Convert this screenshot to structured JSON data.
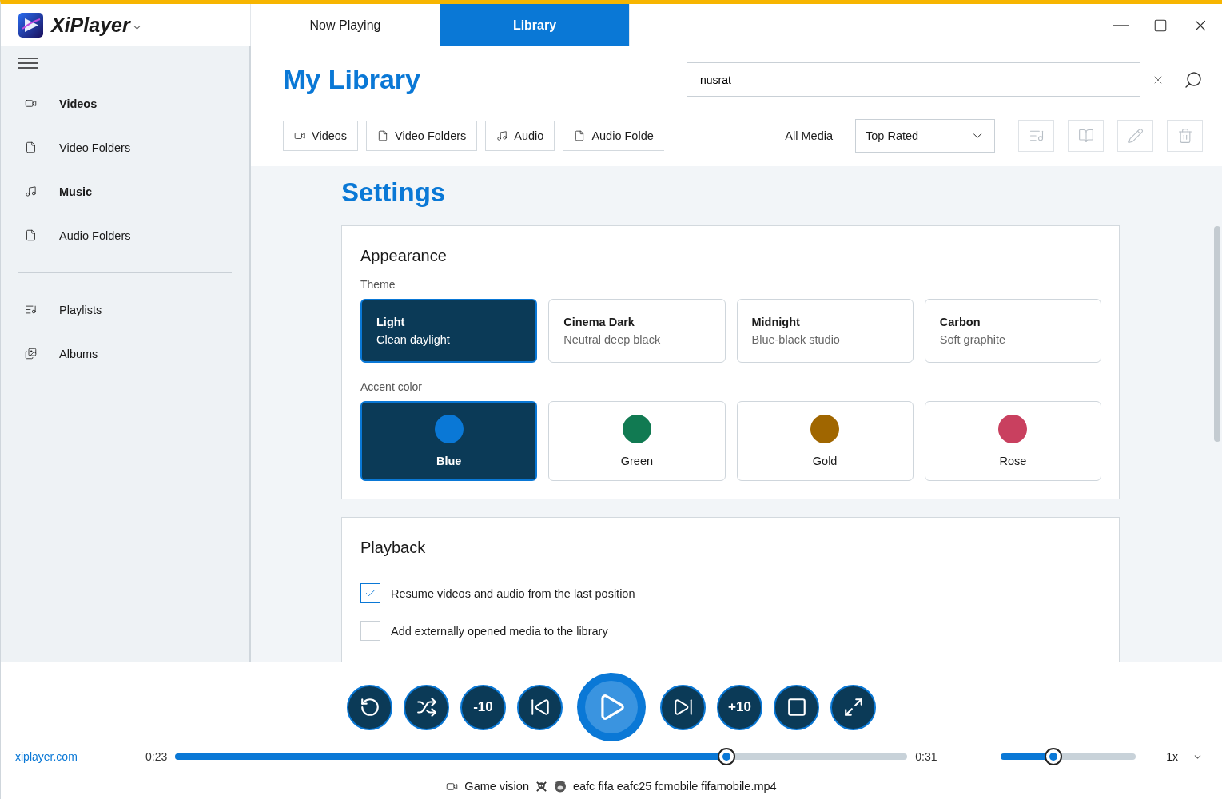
{
  "app": {
    "name": "XiPlayer"
  },
  "tabs": [
    {
      "label": "Now Playing",
      "selected": false
    },
    {
      "label": "Library",
      "selected": true
    }
  ],
  "sidebar": {
    "sections": [
      [
        {
          "label": "Videos",
          "emphasized": true
        },
        {
          "label": "Video Folders",
          "emphasized": false
        },
        {
          "label": "Music",
          "emphasized": true
        },
        {
          "label": "Audio Folders",
          "emphasized": false
        }
      ],
      [
        {
          "label": "Playlists",
          "emphasized": false
        },
        {
          "label": "Albums",
          "emphasized": false
        }
      ]
    ]
  },
  "library": {
    "title": "My Library",
    "search": {
      "value": "nusrat"
    },
    "filters": [
      {
        "label": "Videos"
      },
      {
        "label": "Video Folders"
      },
      {
        "label": "Audio"
      },
      {
        "label": "Audio Folde"
      }
    ],
    "scope_label": "All Media",
    "sort": "Top Rated",
    "tools": [
      {
        "disabled": true
      },
      {
        "disabled": true
      },
      {
        "disabled": true
      },
      {
        "disabled": true
      }
    ]
  },
  "settings": {
    "title": "Settings",
    "appearance": {
      "title": "Appearance",
      "theme_label": "Theme",
      "themes": [
        {
          "name": "Light",
          "description": "Clean daylight",
          "selected": true
        },
        {
          "name": "Cinema Dark",
          "description": "Neutral deep black",
          "selected": false
        },
        {
          "name": "Midnight",
          "description": "Blue-black studio",
          "selected": false
        },
        {
          "name": "Carbon",
          "description": "Soft graphite",
          "selected": false
        }
      ],
      "accent_label": "Accent color",
      "accents": [
        {
          "name": "Blue",
          "color": "#0a78d6",
          "selected": true
        },
        {
          "name": "Green",
          "color": "#117a52",
          "selected": false
        },
        {
          "name": "Gold",
          "color": "#a06600",
          "selected": false
        },
        {
          "name": "Rose",
          "color": "#c9405f",
          "selected": false
        }
      ]
    },
    "playback": {
      "title": "Playback",
      "options": [
        {
          "label": "Resume videos and audio from the last position",
          "checked": true
        },
        {
          "label": "Add externally opened media to the library",
          "checked": false
        }
      ]
    }
  },
  "player": {
    "controls": [
      {
        "kind": "icon"
      },
      {
        "kind": "icon"
      },
      {
        "kind": "text",
        "label": "-10"
      },
      {
        "kind": "icon"
      },
      {
        "kind": "play"
      },
      {
        "kind": "icon"
      },
      {
        "kind": "text",
        "label": "+10"
      },
      {
        "kind": "icon"
      },
      {
        "kind": "icon"
      }
    ],
    "link": "xiplayer.com",
    "elapsed": "0:23",
    "total": "0:31",
    "progress": {
      "level": 0.753
    },
    "volume": {
      "level": 0.39
    },
    "speed": "1x",
    "now_playing": {
      "prefix": "Game vision",
      "title": "eafc fifa eafc25 fcmobile fifamobile.mp4"
    }
  }
}
